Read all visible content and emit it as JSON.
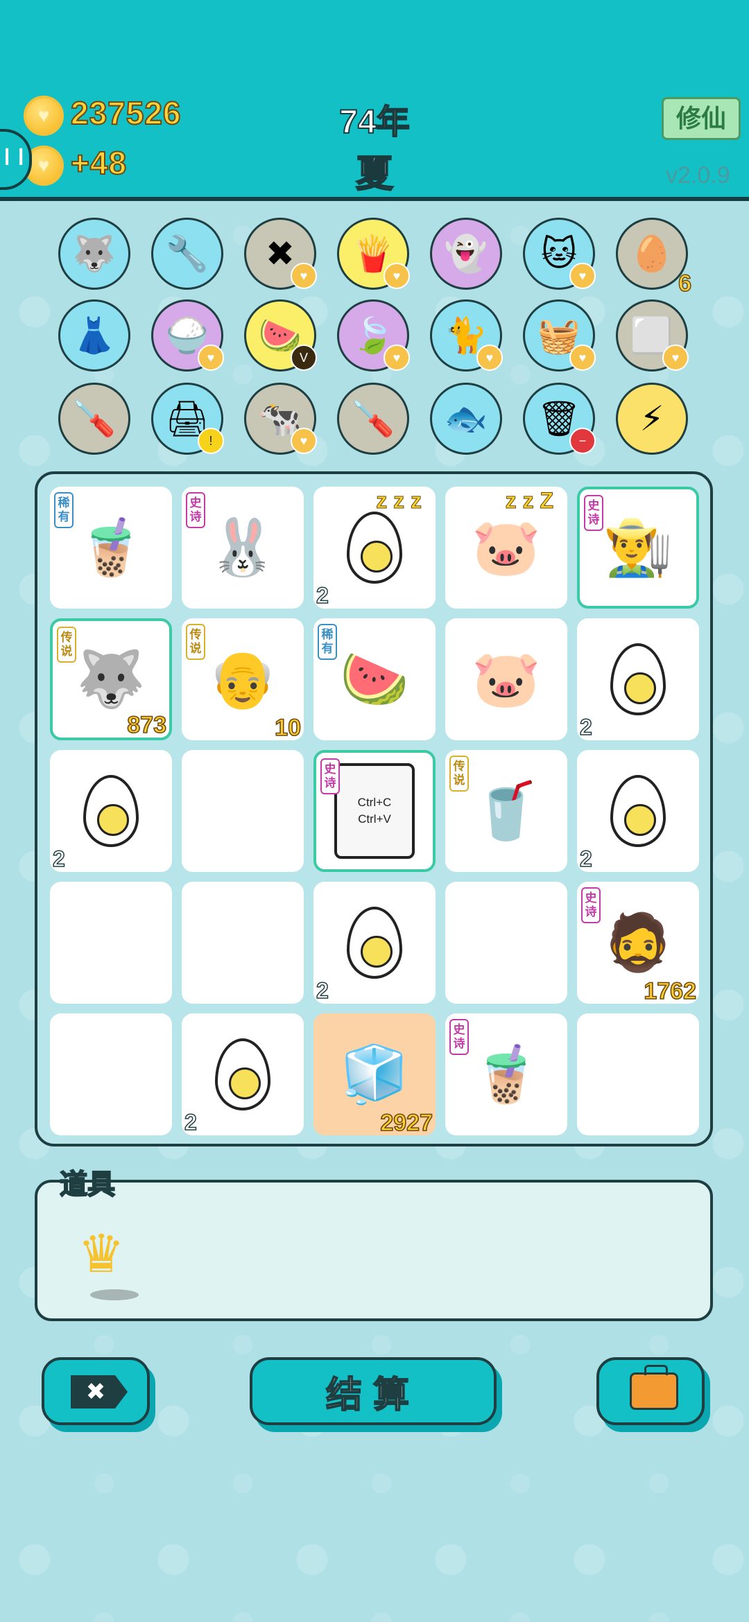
{
  "header": {
    "coins": "237526",
    "income": "+48",
    "year": "74年",
    "season": "夏",
    "mode_label": "修仙",
    "version": "v2.0.9"
  },
  "inventory_rows": [
    [
      {
        "icon": "husky-dog-icon",
        "glyph": "🐺",
        "bg": "#8de0f0"
      },
      {
        "icon": "air-pump-icon",
        "glyph": "🔧",
        "bg": "#8de0f0"
      },
      {
        "icon": "cancel-tag-icon",
        "glyph": "✖",
        "bg": "#c8c6b4",
        "heart": true
      },
      {
        "icon": "fries-icon",
        "glyph": "🍟",
        "bg": "#fbef6a",
        "heart": true
      },
      {
        "icon": "ghost-icon",
        "glyph": "👻",
        "bg": "#d6a9e8"
      },
      {
        "icon": "cat-icon",
        "glyph": "🐱",
        "bg": "#8de0f0",
        "heart": true
      },
      {
        "icon": "egg-tray-icon",
        "glyph": "🥚",
        "bg": "#c8c6b4",
        "count": "6"
      }
    ],
    [
      {
        "icon": "skirt-icon",
        "glyph": "👗",
        "bg": "#8de0f0"
      },
      {
        "icon": "rice-bowl-icon",
        "glyph": "🍚",
        "bg": "#d6a9e8",
        "heart": true
      },
      {
        "icon": "fruit-platter-icon",
        "glyph": "🍉",
        "bg": "#fbef6a",
        "badge": "V"
      },
      {
        "icon": "leaf-icon",
        "glyph": "🍃",
        "bg": "#d6a9e8",
        "heart": true
      },
      {
        "icon": "cat-back-icon",
        "glyph": "🐈",
        "bg": "#8de0f0",
        "heart": true
      },
      {
        "icon": "fruit-basket-icon",
        "glyph": "🧺",
        "bg": "#8de0f0",
        "heart": true
      },
      {
        "icon": "sugar-cubes-icon",
        "glyph": "⬜",
        "bg": "#c8c6b4",
        "heart": true
      }
    ],
    [
      {
        "icon": "screwdriver-icon",
        "glyph": "🪛",
        "bg": "#c8c6b4"
      },
      {
        "icon": "printer-icon",
        "glyph": "🖨",
        "bg": "#8de0f0",
        "warn": true
      },
      {
        "icon": "cows-icon",
        "glyph": "🐄",
        "bg": "#c8c6b4",
        "heart": true
      },
      {
        "icon": "screwdriver-icon",
        "glyph": "🪛",
        "bg": "#c8c6b4"
      },
      {
        "icon": "fish-tank-icon",
        "glyph": "🐟",
        "bg": "#8de0f0"
      },
      {
        "icon": "trash-bag-icon",
        "glyph": "🗑",
        "bg": "#8de0f0",
        "minus": true
      },
      {
        "icon": "lightning-icon",
        "glyph": "⚡",
        "bg": "#fbe06a"
      }
    ]
  ],
  "board": [
    [
      {
        "icon": "milk-tea-cup-icon",
        "glyph": "🧋",
        "rarity": "稀有",
        "rclass": "r1"
      },
      {
        "icon": "rabbit-house-icon",
        "glyph": "🐰",
        "rarity": "史诗",
        "rclass": "r2"
      },
      {
        "icon": "egg-icon",
        "egg": true,
        "zzz": "z z z",
        "count": "2"
      },
      {
        "icon": "pig-icon",
        "glyph": "🐷",
        "zzz": "z z Z"
      },
      {
        "icon": "farmer-face-icon",
        "glyph": "👨‍🌾",
        "rarity": "史诗",
        "rclass": "r2",
        "hl": true
      }
    ],
    [
      {
        "icon": "husky-king-icon",
        "glyph": "🐺",
        "rarity": "传说",
        "rclass": "r3",
        "hl": true,
        "big": "873"
      },
      {
        "icon": "old-man-glasses-icon",
        "glyph": "👴",
        "rarity": "传说",
        "rclass": "r3",
        "big": "10"
      },
      {
        "icon": "watermelon-icon",
        "glyph": "🍉",
        "rarity": "稀有",
        "rclass": "r1"
      },
      {
        "icon": "pig-icon",
        "glyph": "🐷"
      },
      {
        "icon": "egg-icon",
        "egg": true,
        "count": "2"
      }
    ],
    [
      {
        "icon": "egg-icon",
        "egg": true,
        "count": "2"
      },
      {
        "icon": "empty-slot"
      },
      {
        "icon": "copy-paste-card-icon",
        "ctrl": [
          "Ctrl+C",
          "Ctrl+V"
        ],
        "rarity": "史诗",
        "rclass": "r2",
        "hl": true
      },
      {
        "icon": "bubble-tea-icon",
        "glyph": "🥤",
        "rarity": "传说",
        "rclass": "r3"
      },
      {
        "icon": "egg-icon",
        "egg": true,
        "count": "2"
      }
    ],
    [
      {
        "icon": "empty-slot"
      },
      {
        "icon": "empty-slot"
      },
      {
        "icon": "egg-icon",
        "egg": true,
        "count": "2"
      },
      {
        "icon": "empty-slot"
      },
      {
        "icon": "bearded-man-icon",
        "glyph": "🧔",
        "rarity": "史诗",
        "rclass": "r2",
        "big": "1762"
      }
    ],
    [
      {
        "icon": "empty-slot"
      },
      {
        "icon": "egg-icon",
        "egg": true,
        "count": "2"
      },
      {
        "icon": "fridge-icon",
        "glyph": "🧊",
        "orange": true,
        "big": "2927"
      },
      {
        "icon": "milk-tea-cup-icon",
        "glyph": "🧋",
        "rarity": "史诗",
        "rclass": "r2"
      },
      {
        "icon": "empty-slot"
      }
    ]
  ],
  "props": {
    "label": "道具",
    "items": [
      {
        "icon": "crown-icon",
        "glyph": "♛"
      }
    ]
  },
  "buttons": {
    "skip": "✖",
    "settle": "结算",
    "bag_icon": "briefcase-icon"
  }
}
